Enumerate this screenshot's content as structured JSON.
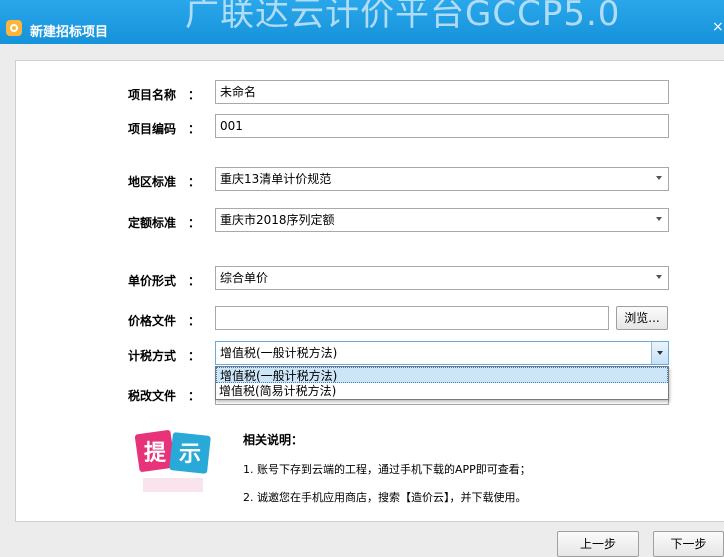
{
  "window": {
    "title": "新建招标项目",
    "background_banner": "广联达云计价平台GCCP5.0",
    "close_glyph": "×"
  },
  "form": {
    "colon": "：",
    "project_name": {
      "label": "项目名称",
      "value": "未命名"
    },
    "project_code": {
      "label": "项目编码",
      "value": "001"
    },
    "region_standard": {
      "label": "地区标准",
      "value": "重庆13清单计价规范"
    },
    "quota_standard": {
      "label": "定额标准",
      "value": "重庆市2018序列定额"
    },
    "unit_price_form": {
      "label": "单价形式",
      "value": "综合单价"
    },
    "price_file": {
      "label": "价格文件",
      "value": "",
      "browse_label": "浏览..."
    },
    "tax_method": {
      "label": "计税方式",
      "value": "增值税(一般计税方法)",
      "options": [
        "增值税(一般计税方法)",
        "增值税(简易计税方法)"
      ],
      "highlighted_index": 0
    },
    "tax_reform_file": {
      "label": "税改文件",
      "value": ""
    }
  },
  "notes": {
    "icon_text": [
      "提",
      "示"
    ],
    "title": "相关说明：",
    "items": [
      "1. 账号下存到云端的工程，通过手机下载的APP即可查看；",
      "2. 诚邀您在手机应用商店，搜索【造价云】，并下载使用。"
    ]
  },
  "footer": {
    "prev_label": "上一步",
    "next_label": "下一步"
  },
  "colors": {
    "titlebar": "#1e9de4",
    "tip_pink": "#e6337a",
    "tip_cyan": "#29a9d8"
  }
}
